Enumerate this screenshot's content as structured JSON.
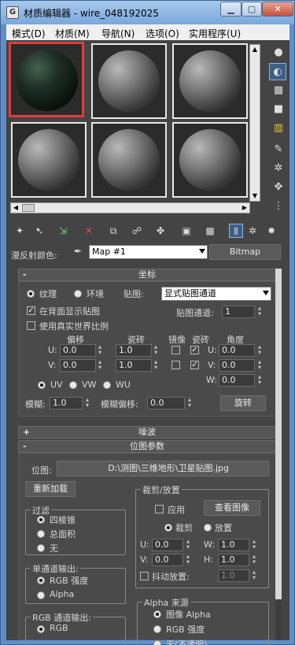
{
  "window": {
    "title": "材质编辑器 - wire_048192025",
    "app_icon": "G",
    "minimize": "▁",
    "maximize": "▢",
    "close": "✕"
  },
  "menu": [
    "模式(D)",
    "材质(M)",
    "导航(N)",
    "选项(O)",
    "实用程序(U)"
  ],
  "toolbar": {
    "diffuse_label": "漫反射颜色:",
    "map_name": "Map #1",
    "map_type": "Bitmap"
  },
  "coordinates": {
    "header": "坐标",
    "sign": "-",
    "texture_label": "纹理",
    "environ_label": "环境",
    "mapping_label": "贴图:",
    "mapping_value": "显式贴图通道",
    "show_back_label": "在背面显示贴图",
    "real_world_label": "使用真实世界比例",
    "map_channel_label": "贴图通道:",
    "map_channel_value": "1",
    "offset_label": "偏移",
    "tiling_label": "瓷砖",
    "mirror_label": "镜像",
    "tile_label": "瓷砖",
    "angle_label": "角度",
    "u_label": "U:",
    "v_label": "V:",
    "w_label": "W:",
    "u_offset": "0.0",
    "v_offset": "0.0",
    "u_tiling": "1.0",
    "v_tiling": "1.0",
    "u_angle": "0.0",
    "v_angle": "0.0",
    "w_angle": "0.0",
    "uv_label": "UV",
    "vw_label": "VW",
    "wu_label": "WU",
    "blur_label": "模糊:",
    "blur_value": "1.0",
    "blur_offset_label": "模糊偏移:",
    "blur_offset_value": "0.0",
    "rotate_button": "旋转"
  },
  "noise": {
    "header": "噪波",
    "sign": "+"
  },
  "bitmap_params": {
    "header": "位图参数",
    "sign": "-",
    "bitmap_label": "位图:",
    "bitmap_path": "D:\\测图\\三维地形\\卫星贴图.jpg",
    "reload_button": "重新加载",
    "crop_title": "裁剪/放置",
    "apply_label": "应用",
    "view_image_button": "查看图像",
    "crop_label": "裁剪",
    "place_label": "放置",
    "u_label": "U:",
    "v_label": "V:",
    "w_label": "W:",
    "h_label": "H:",
    "u_value": "0.0",
    "v_value": "0.0",
    "w_value": "1.0",
    "h_value": "1.0",
    "jitter_label": "抖动放置:",
    "jitter_value": "1.0",
    "filter_title": "过滤",
    "filter_options": [
      "四棱锥",
      "总面积",
      "无"
    ],
    "mono_title": "单通道输出:",
    "mono_options": [
      "RGB 强度",
      "Alpha"
    ],
    "rgb_title": "RGB 通道输出:",
    "rgb_options": [
      "RGB"
    ],
    "alpha_title": "Alpha 来源",
    "alpha_options": [
      "图像 Alpha",
      "RGB 强度",
      "无(不透明)"
    ]
  }
}
